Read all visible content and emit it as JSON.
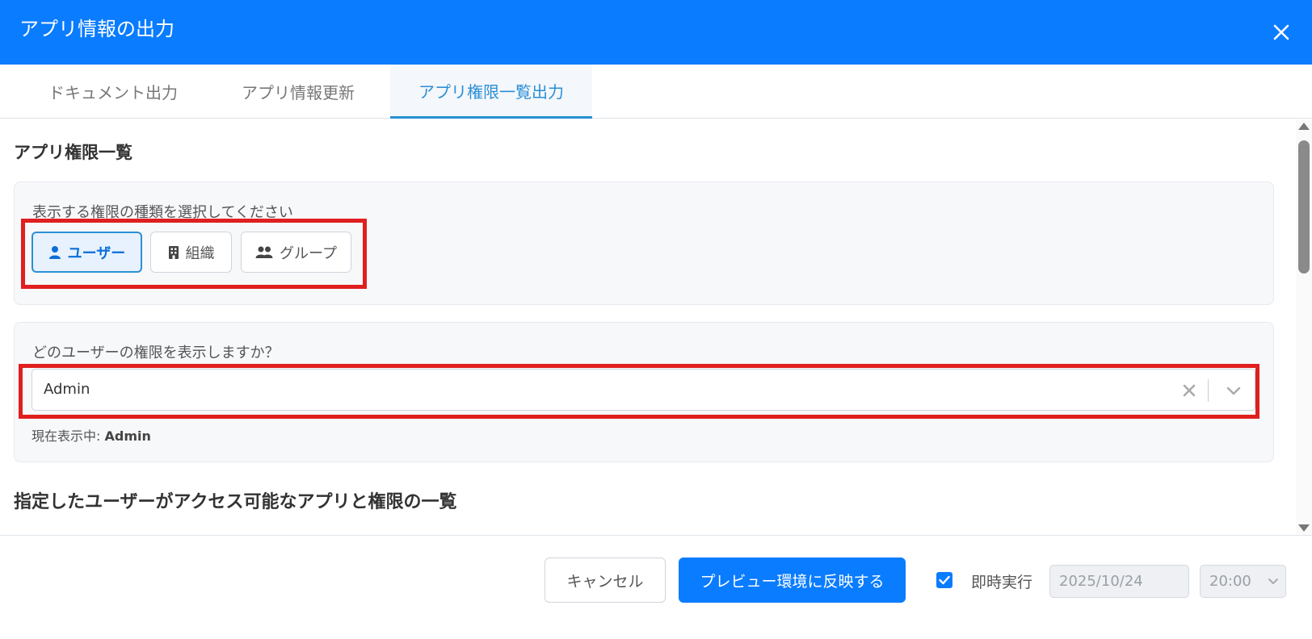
{
  "header": {
    "title": "アプリ情報の出力"
  },
  "tabs": [
    {
      "label": "ドキュメント出力",
      "active": false
    },
    {
      "label": "アプリ情報更新",
      "active": false
    },
    {
      "label": "アプリ権限一覧出力",
      "active": true
    }
  ],
  "section": {
    "title": "アプリ権限一覧",
    "type_prompt": "表示する権限の種類を選択してください",
    "types": [
      {
        "label": "ユーザー",
        "icon": "user-icon",
        "selected": true
      },
      {
        "label": "組織",
        "icon": "building-icon",
        "selected": false
      },
      {
        "label": "グループ",
        "icon": "group-icon",
        "selected": false
      }
    ],
    "user_prompt": "どのユーザーの権限を表示しますか？",
    "user_select_value": "Admin",
    "current_display_label": "現在表示中: ",
    "current_display_value": "Admin",
    "list_title": "指定したユーザーがアクセス可能なアプリと権限の一覧"
  },
  "footer": {
    "cancel_label": "キャンセル",
    "apply_label": "プレビュー環境に反映する",
    "immediate_label": "即時実行",
    "immediate_checked": true,
    "date_value": "2025/10/24",
    "time_value": "20:00"
  },
  "colors": {
    "primary": "#0a7cff",
    "accent_tab": "#2a8fd6",
    "highlight": "#e01f1f"
  }
}
